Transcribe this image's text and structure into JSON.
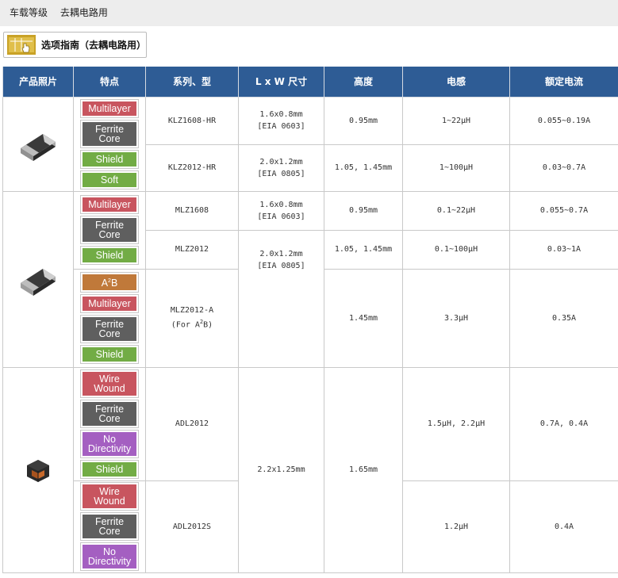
{
  "breadcrumb": {
    "items": [
      "车载等级",
      "去耦电路用"
    ]
  },
  "guide_button": {
    "label": "选项指南（去耦电路用）",
    "icon": "pointing-hand-icon"
  },
  "table": {
    "headers": [
      "产品照片",
      "特点",
      "系列、型",
      "L x W 尺寸",
      "高度",
      "电感",
      "额定电流"
    ],
    "badge_colors": {
      "red": "#c8555f",
      "gray": "#5f5f5f",
      "green": "#72ac45",
      "brown": "#c0793a",
      "purple": "#a45fc1"
    },
    "group1": {
      "image": "chip-inductor-image",
      "badges": [
        "Multilayer",
        "Ferrite\nCore",
        "Shield",
        "Soft"
      ],
      "rows": [
        {
          "series": "KLZ1608-HR",
          "size": "1.6x0.8mm\n[EIA 0603]",
          "height": "0.95mm",
          "inductance": "1~22μH",
          "current": "0.055~0.19A"
        },
        {
          "series": "KLZ2012-HR",
          "size": "2.0x1.2mm\n[EIA 0805]",
          "height": "1.05, 1.45mm",
          "inductance": "1~100μH",
          "current": "0.03~0.7A"
        }
      ]
    },
    "group2": {
      "image": "chip-inductor-image",
      "badges_a": [
        "Multilayer",
        "Ferrite\nCore",
        "Shield"
      ],
      "badges_b": [
        "A2B",
        "Multilayer",
        "Ferrite\nCore",
        "Shield"
      ],
      "rows": [
        {
          "series": "MLZ1608",
          "size": "1.6x0.8mm\n[EIA 0603]",
          "height": "0.95mm",
          "inductance": "0.1~22μH",
          "current": "0.055~0.7A"
        },
        {
          "series": "MLZ2012",
          "size": "2.0x1.2mm\n[EIA 0805]",
          "height": "1.05, 1.45mm",
          "inductance": "0.1~100μH",
          "current": "0.03~1A"
        },
        {
          "series": "MLZ2012-A",
          "series_note": "(For A2B)",
          "height": "1.45mm",
          "inductance": "3.3μH",
          "current": "0.35A"
        }
      ]
    },
    "group3": {
      "image": "wire-wound-inductor-image",
      "badges_a": [
        "Wire\nWound",
        "Ferrite\nCore",
        "No\nDirectivity",
        "Shield"
      ],
      "badges_b": [
        "Wire\nWound",
        "Ferrite\nCore",
        "No\nDirectivity"
      ],
      "size": "2.2x1.25mm",
      "height": "1.65mm",
      "rows": [
        {
          "series": "ADL2012",
          "inductance": "1.5μH, 2.2μH",
          "current": "0.7A, 0.4A"
        },
        {
          "series": "ADL2012S",
          "inductance": "1.2μH",
          "current": "0.4A"
        }
      ]
    }
  }
}
